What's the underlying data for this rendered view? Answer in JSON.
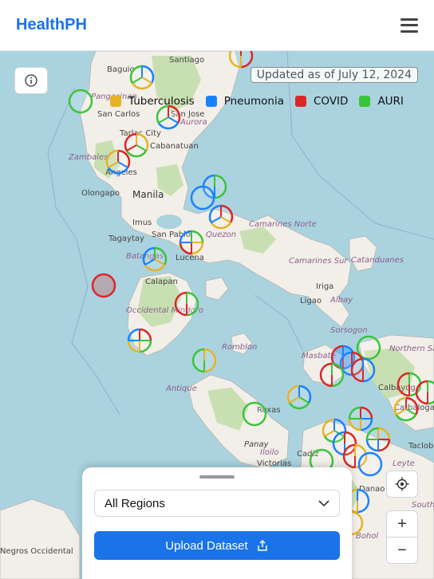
{
  "header": {
    "brand": "HealthPH",
    "menu_icon": "hamburger-menu-icon"
  },
  "map": {
    "updated_text": "Updated as of July 12, 2024",
    "info_icon": "info-icon",
    "legend": [
      {
        "label": "Tuberculosis",
        "color": "#e6b325"
      },
      {
        "label": "Pneumonia",
        "color": "#1a82ff"
      },
      {
        "label": "COVID",
        "color": "#dc2626"
      },
      {
        "label": "AURI",
        "color": "#3ac43a"
      }
    ],
    "place_labels": [
      "Baguio",
      "Santiago",
      "Pangasinan",
      "San Carlos",
      "Tarlac City",
      "Aurora",
      "San Jose",
      "Zambales",
      "Angeles",
      "Cabanatuan",
      "Olongapo",
      "Manila",
      "Imus",
      "San Pablo",
      "Quezon",
      "Tagaytay",
      "Batangas",
      "Lucena",
      "Camarines Norte",
      "Camarines Sur",
      "Catanduanes",
      "Calapan",
      "Iriga",
      "Ligao",
      "Albay",
      "Occidental Mindoro",
      "Sorsogon",
      "Romblon",
      "Masbate",
      "Northern Samar",
      "Antique",
      "Roxas",
      "Calbayog",
      "Catbalogan",
      "Panay",
      "Iloilo",
      "Victorias",
      "Cadiz",
      "Tacloban",
      "Leyte",
      "Danao",
      "Bohol",
      "South",
      "Negros Occidental"
    ],
    "controls": {
      "locate_icon": "locate-icon",
      "zoom_in": "+",
      "zoom_out": "−"
    }
  },
  "panel": {
    "region_select": "All Regions",
    "upload_label": "Upload Dataset",
    "upload_icon": "upload-icon"
  }
}
